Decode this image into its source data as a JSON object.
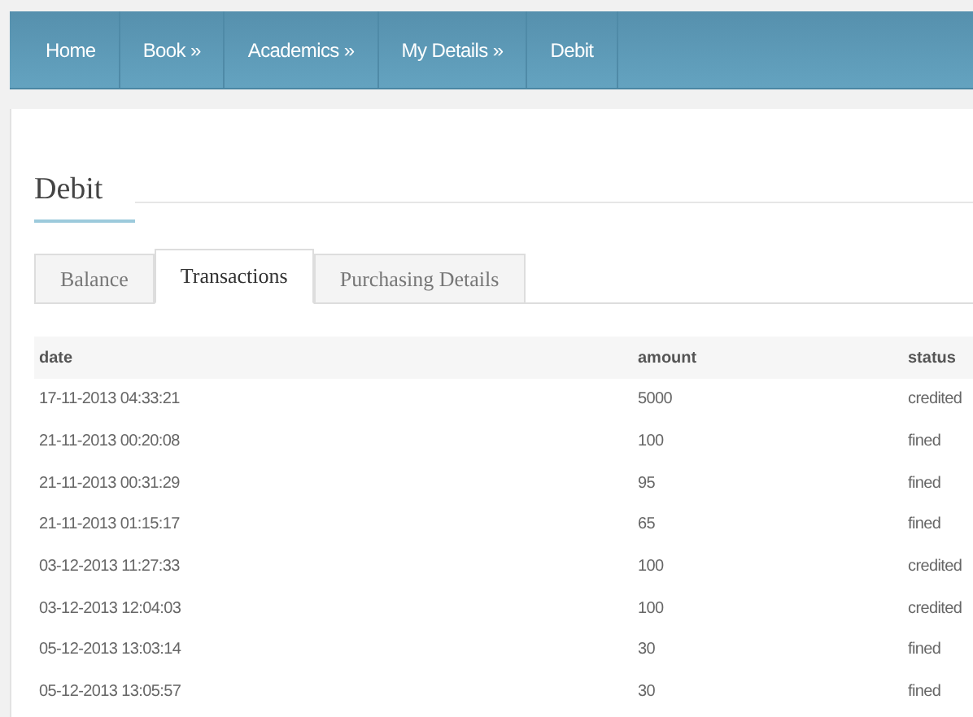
{
  "nav": [
    {
      "label": "Home"
    },
    {
      "label": "Book »"
    },
    {
      "label": "Academics »"
    },
    {
      "label": "My Details »"
    },
    {
      "label": "Debit"
    }
  ],
  "heading": "Debit",
  "tabs": [
    {
      "label": "Balance",
      "selected": false
    },
    {
      "label": "Transactions",
      "selected": true
    },
    {
      "label": "Purchasing Details",
      "selected": false
    }
  ],
  "table": {
    "columns": [
      "date",
      "amount",
      "status"
    ],
    "rows": [
      [
        "17-11-2013 04:33:21",
        "5000",
        "credited"
      ],
      [
        "21-11-2013 00:20:08",
        "100",
        "fined"
      ],
      [
        "21-11-2013 00:31:29",
        "95",
        "fined"
      ],
      [
        "21-11-2013 01:15:17",
        "65",
        "fined"
      ],
      [
        "03-12-2013 11:27:33",
        "100",
        "credited"
      ],
      [
        "03-12-2013 12:04:03",
        "100",
        "credited"
      ],
      [
        "05-12-2013 13:03:14",
        "30",
        "fined"
      ],
      [
        "05-12-2013 13:05:57",
        "30",
        "fined"
      ]
    ]
  }
}
